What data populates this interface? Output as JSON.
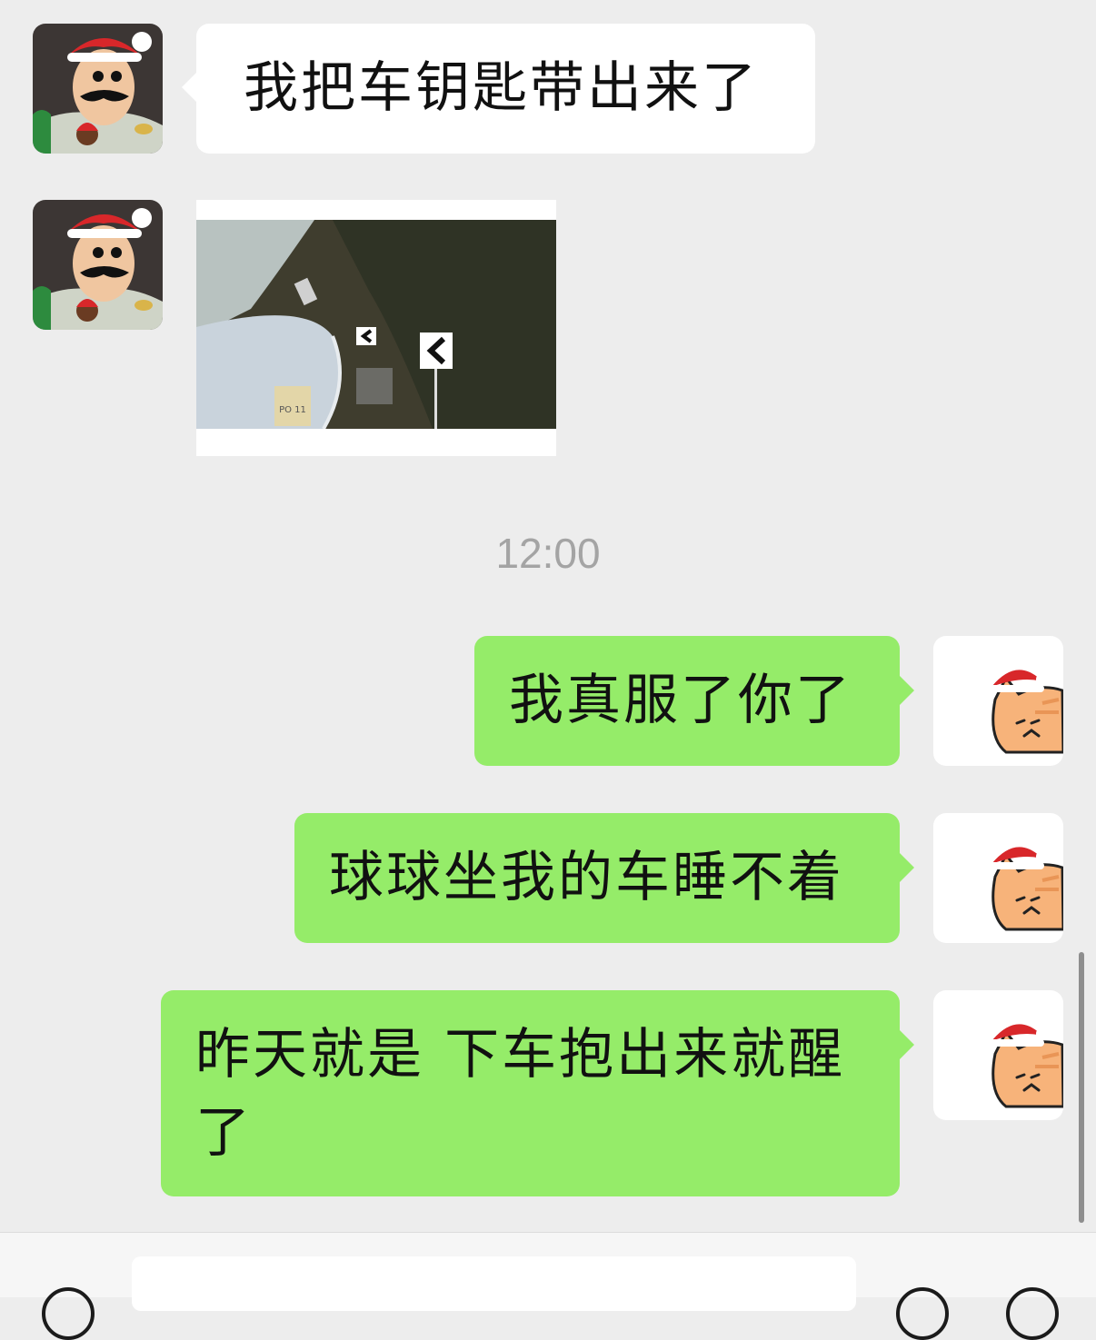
{
  "messages": [
    {
      "side": "in",
      "type": "text",
      "text": "我把车钥匙带出来了",
      "avatar": "cartoon-man-santa-hat-avatar"
    },
    {
      "side": "in",
      "type": "image",
      "sign_text": "PO 11",
      "avatar": "cartoon-man-santa-hat-avatar"
    },
    {
      "type": "time",
      "text": "12:00"
    },
    {
      "side": "out",
      "type": "text",
      "text": "我真服了你了",
      "avatar": "cat-santa-hat-avatar"
    },
    {
      "side": "out",
      "type": "text",
      "text": "球球坐我的车睡不着",
      "avatar": "cat-santa-hat-avatar"
    },
    {
      "side": "out",
      "type": "text",
      "text_line1": "昨天就是 下车抱出来就醒",
      "text_line2": "了",
      "avatar": "cat-santa-hat-avatar"
    }
  ],
  "colors": {
    "background": "#ededed",
    "incoming_bubble": "#ffffff",
    "outgoing_bubble": "#95ec69",
    "timestamp": "#a4a4a4"
  },
  "input_bar": {
    "left_button_icon": "voice-icon",
    "right_button_icons": [
      "emoji-icon",
      "plus-icon"
    ]
  }
}
